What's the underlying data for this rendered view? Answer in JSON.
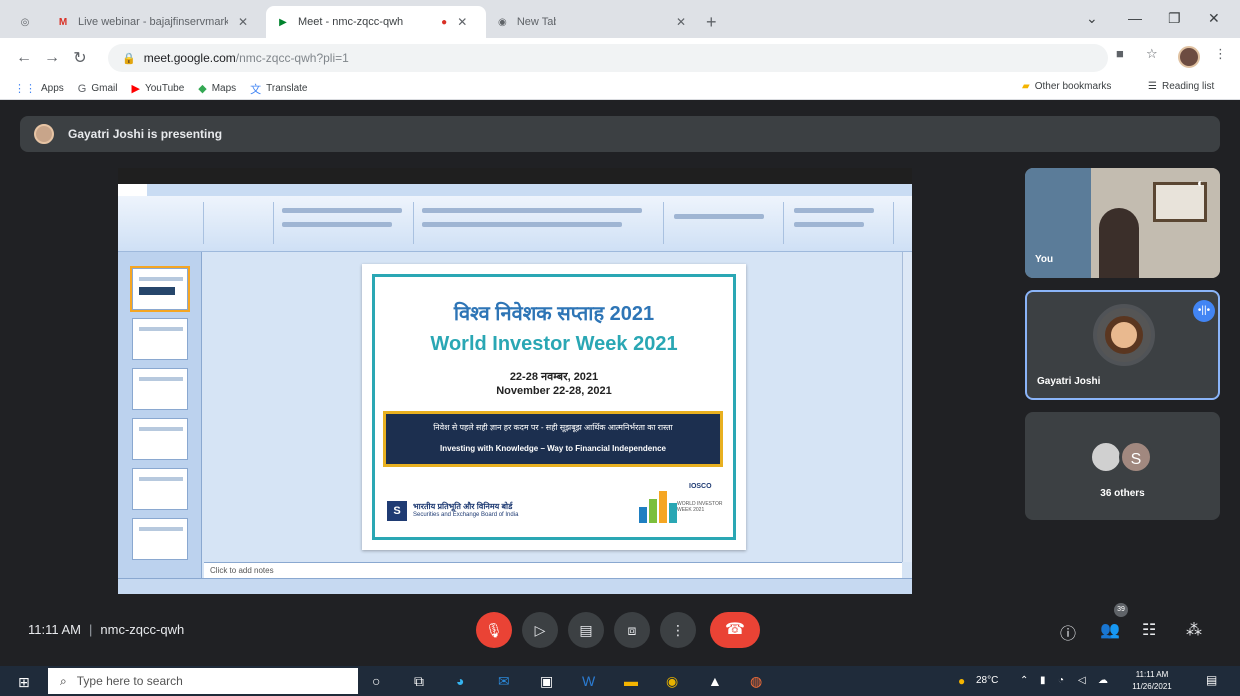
{
  "browser": {
    "tabs": [
      {
        "label": "Live webinar - bajajfinservmarkets",
        "icon": "gmail-icon"
      },
      {
        "label": "Meet - nmc-zqcc-qwh",
        "icon": "meet-icon"
      },
      {
        "label": "New Tab",
        "icon": "chrome-icon"
      }
    ],
    "url_host": "meet.google.com",
    "url_path": "/nmc-zqcc-qwh?pli=1",
    "bookmarks": [
      {
        "label": "Apps",
        "icon": "apps-grid-icon"
      },
      {
        "label": "Gmail",
        "icon": "gmail-icon"
      },
      {
        "label": "YouTube",
        "icon": "youtube-icon"
      },
      {
        "label": "Maps",
        "icon": "maps-icon"
      },
      {
        "label": "Translate",
        "icon": "translate-icon"
      }
    ],
    "other_bookmarks": "Other bookmarks",
    "reading_list": "Reading list"
  },
  "meet": {
    "presenting_banner": "Gayatri Joshi is presenting",
    "time": "11:11 AM",
    "meeting_code": "nmc-zqcc-qwh",
    "participants": {
      "self_label": "You",
      "speaker_name": "Gayatri Joshi",
      "others_initial": "S",
      "others_label": "36 others"
    },
    "people_count": "39",
    "colors": {
      "hangup": "#ea4335",
      "active_border": "#8ab4f8",
      "bg": "#202124"
    }
  },
  "slide": {
    "title_hindi": "विश्व निवेशक सप्ताह 2021",
    "title_english": "World Investor Week 2021",
    "date_hindi": "22-28 नवम्बर, 2021",
    "date_english": "November 22-28, 2021",
    "banner_hindi": "निवेश से पहले सही ज्ञान हर कदम पर - सही सूझबूझ आर्थिक आत्मनिर्भरता का रास्ता",
    "banner_english": "Investing with Knowledge – Way to Financial Independence",
    "logo_letter": "S",
    "sebi_hindi": "भारतीय प्रतिभूति और विनिमय बोर्ड",
    "sebi_english": "Securities and Exchange Board of India",
    "iosco": "IOSCO",
    "iosco_sub": "WORLD INVESTOR WEEK 2021",
    "notes_placeholder": "Click to add notes"
  },
  "taskbar": {
    "search_placeholder": "Type here to search",
    "temperature": "28°C",
    "clock_time": "11:11 AM",
    "clock_date": "11/26/2021"
  }
}
